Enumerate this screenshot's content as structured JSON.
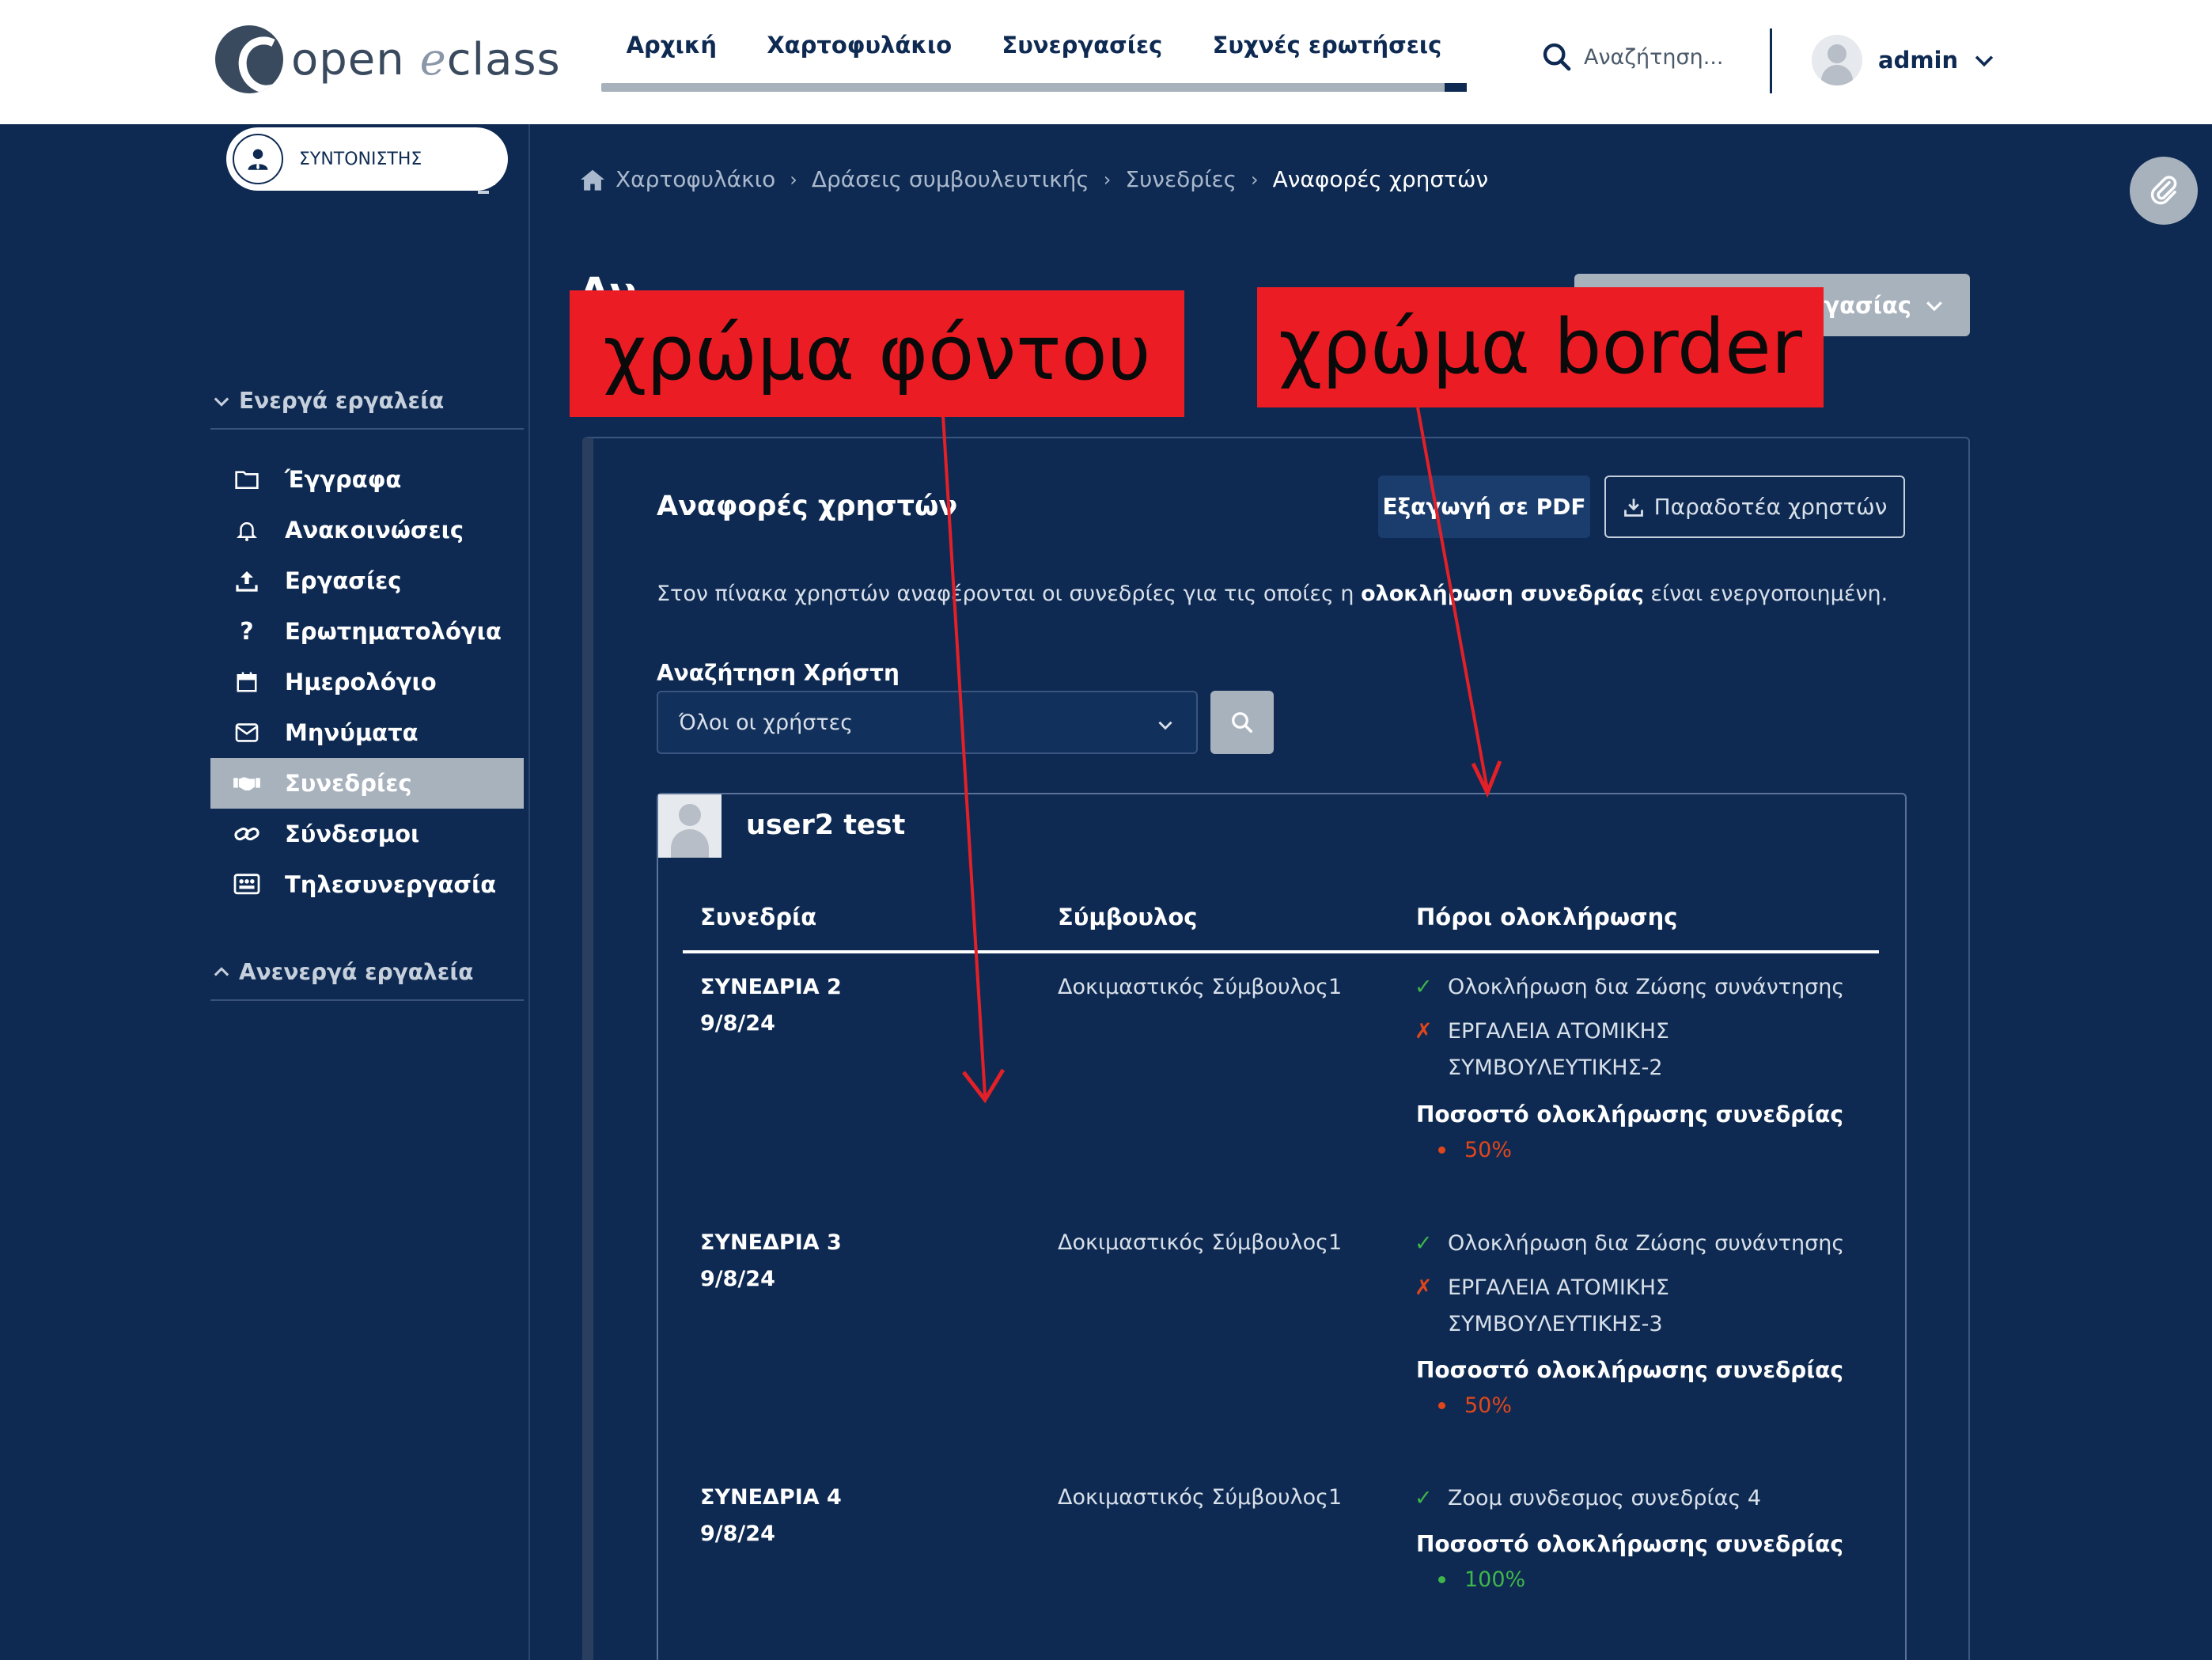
{
  "header": {
    "logo_text_left": "open",
    "logo_text_e": "e",
    "logo_text_right": "class",
    "nav": [
      "Αρχική",
      "Χαρτοφυλάκιο",
      "Συνεργασίες",
      "Συχνές ερωτήσεις"
    ],
    "search_placeholder": "Αναζήτηση...",
    "username": "admin"
  },
  "sidebar": {
    "role": "ΣΥΝΤΟΝΙΣΤΗΣ",
    "active_tools_title": "Ενεργά εργαλεία",
    "tools": [
      {
        "label": "Έγγραφα",
        "icon": "folder-icon"
      },
      {
        "label": "Ανακοινώσεις",
        "icon": "bell-icon"
      },
      {
        "label": "Εργασίες",
        "icon": "upload-icon"
      },
      {
        "label": "Ερωτηματολόγια",
        "icon": "question-icon"
      },
      {
        "label": "Ημερολόγιο",
        "icon": "calendar-icon"
      },
      {
        "label": "Μηνύματα",
        "icon": "envelope-icon"
      },
      {
        "label": "Συνεδρίες",
        "icon": "handshake-icon",
        "active": true
      },
      {
        "label": "Σύνδεσμοι",
        "icon": "link-icon"
      },
      {
        "label": "Τηλεσυνεργασία",
        "icon": "teleconference-icon"
      }
    ],
    "inactive_tools_title": "Ανενεργά εργαλεία"
  },
  "breadcrumb": [
    "Χαρτοφυλάκιο",
    "Δράσεις συμβουλευτικής",
    "Συνεδρίες",
    "Αναφορές χρηστών"
  ],
  "page": {
    "title_partial": "Αν",
    "action_button_partial": "γασίας"
  },
  "panel": {
    "title": "Αναφορές χρηστών",
    "export_pdf": "Εξαγωγή σε PDF",
    "deliverables": "Παραδοτέα χρηστών",
    "info_before": "Στον πίνακα χρηστών αναφέρονται οι συνεδρίες για τις οποίες η ",
    "info_bold": "ολοκλήρωση συνεδρίας",
    "info_after": " είναι ενεργοποιημένη.",
    "search_label": "Αναζήτηση Χρήστη",
    "select_value": "Όλοι οι χρήστες"
  },
  "user_card": {
    "name": "user2 test",
    "headers": [
      "Συνεδρία",
      "Σύμβουλος",
      "Πόροι ολοκλήρωσης"
    ],
    "completion_label": "Ποσοστό ολοκλήρωσης συνεδρίας",
    "rows": [
      {
        "session": "ΣΥΝΕΔΡΙΑ 2",
        "date": "9/8/24",
        "consultant": "Δοκιμαστικός Σύμβουλος1",
        "resources": [
          {
            "mark": "✓",
            "status": "done",
            "lines": [
              "Ολοκλήρωση δια Ζώσης συνάντησης"
            ]
          },
          {
            "mark": "✗",
            "status": "missing",
            "lines": [
              "ΕΡΓΑΛΕΙΑ ΑΤΟΜΙΚΗΣ",
              "ΣΥΜΒΟΥΛΕΥΤΙΚΗΣ-2"
            ]
          }
        ],
        "percent": "50%",
        "percent_value": 50
      },
      {
        "session": "ΣΥΝΕΔΡΙΑ 3",
        "date": "9/8/24",
        "consultant": "Δοκιμαστικός Σύμβουλος1",
        "resources": [
          {
            "mark": "✓",
            "status": "done",
            "lines": [
              "Ολοκλήρωση δια Ζώσης συνάντησης"
            ]
          },
          {
            "mark": "✗",
            "status": "missing",
            "lines": [
              "ΕΡΓΑΛΕΙΑ ΑΤΟΜΙΚΗΣ",
              "ΣΥΜΒΟΥΛΕΥΤΙΚΗΣ-3"
            ]
          }
        ],
        "percent": "50%",
        "percent_value": 50
      },
      {
        "session": "ΣΥΝΕΔΡΙΑ 4",
        "date": "9/8/24",
        "consultant": "Δοκιμαστικός Σύμβουλος1",
        "resources": [
          {
            "mark": "✓",
            "status": "done",
            "lines": [
              "Ζοομ συνδεσμος συνεδρίας 4"
            ]
          }
        ],
        "percent": "100%",
        "percent_value": 100
      }
    ]
  },
  "annotations": {
    "background_label": "χρώμα φόντου",
    "border_label": "χρώμα border"
  },
  "colors": {
    "page_bg": "#0e2a52",
    "accent_gray": "#a8b2bd",
    "done_green": "#3fb64a",
    "missing_orange": "#e0461c",
    "annotation_red": "#ec1c24"
  }
}
